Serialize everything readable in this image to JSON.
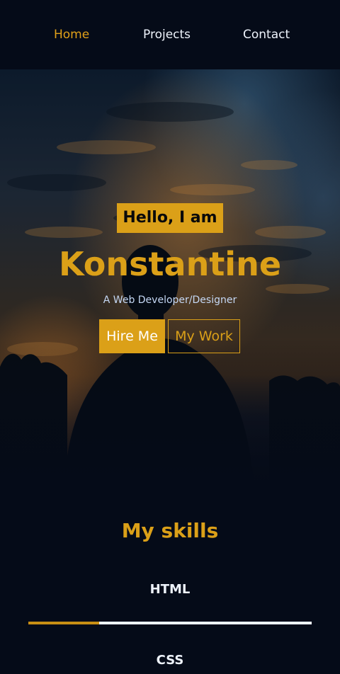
{
  "nav": {
    "items": [
      {
        "label": "Home",
        "active": true
      },
      {
        "label": "Projects",
        "active": false
      },
      {
        "label": "Contact",
        "active": false
      }
    ]
  },
  "hero": {
    "greeting": "Hello, I am",
    "name": "Konstantine",
    "subtitle": "A Web Developer/Designer",
    "primary_button": "Hire Me",
    "secondary_button": "My Work"
  },
  "skills": {
    "title": "My skills",
    "items": [
      {
        "name": "HTML",
        "level": 0.25
      },
      {
        "name": "CSS"
      }
    ]
  },
  "colors": {
    "background": "#050b18",
    "accent": "#dba018",
    "text": "#eef3fb",
    "subtitle": "#c5d8f5"
  }
}
